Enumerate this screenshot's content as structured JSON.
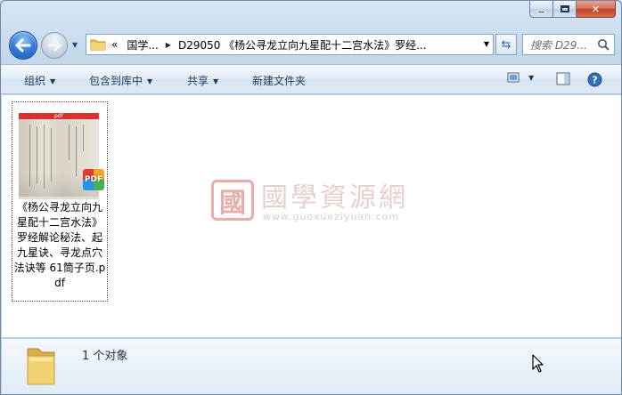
{
  "window": {
    "caption": {
      "min": "minimize",
      "max": "maximize",
      "close": "close"
    }
  },
  "nav": {
    "back_icon": "back-arrow-icon",
    "forward_icon": "forward-arrow-icon",
    "breadcrumb": [
      "«",
      "国学...",
      "D29050 《杨公寻龙立向九星配十二宫水法》罗经..."
    ],
    "search_placeholder": "搜索 D29..."
  },
  "toolbar": {
    "organize": "组织",
    "include_in_library": "包含到库中",
    "share": "共享",
    "new_folder": "新建文件夹"
  },
  "files": [
    {
      "name": "《杨公寻龙立向九星配十二宫水法》罗经解论秘法、起九星诀、寻龙点穴法诀等 61筒子页.pdf",
      "type_badge": "PDF"
    }
  ],
  "watermark": {
    "seal": "國",
    "title": "國學資源網",
    "url": "www.guoxueziyuan.com"
  },
  "details": {
    "count_text": "1 个对象"
  },
  "colors": {
    "accent": "#2f78d6",
    "close": "#c1432a",
    "pdf_red": "#d8322f"
  }
}
